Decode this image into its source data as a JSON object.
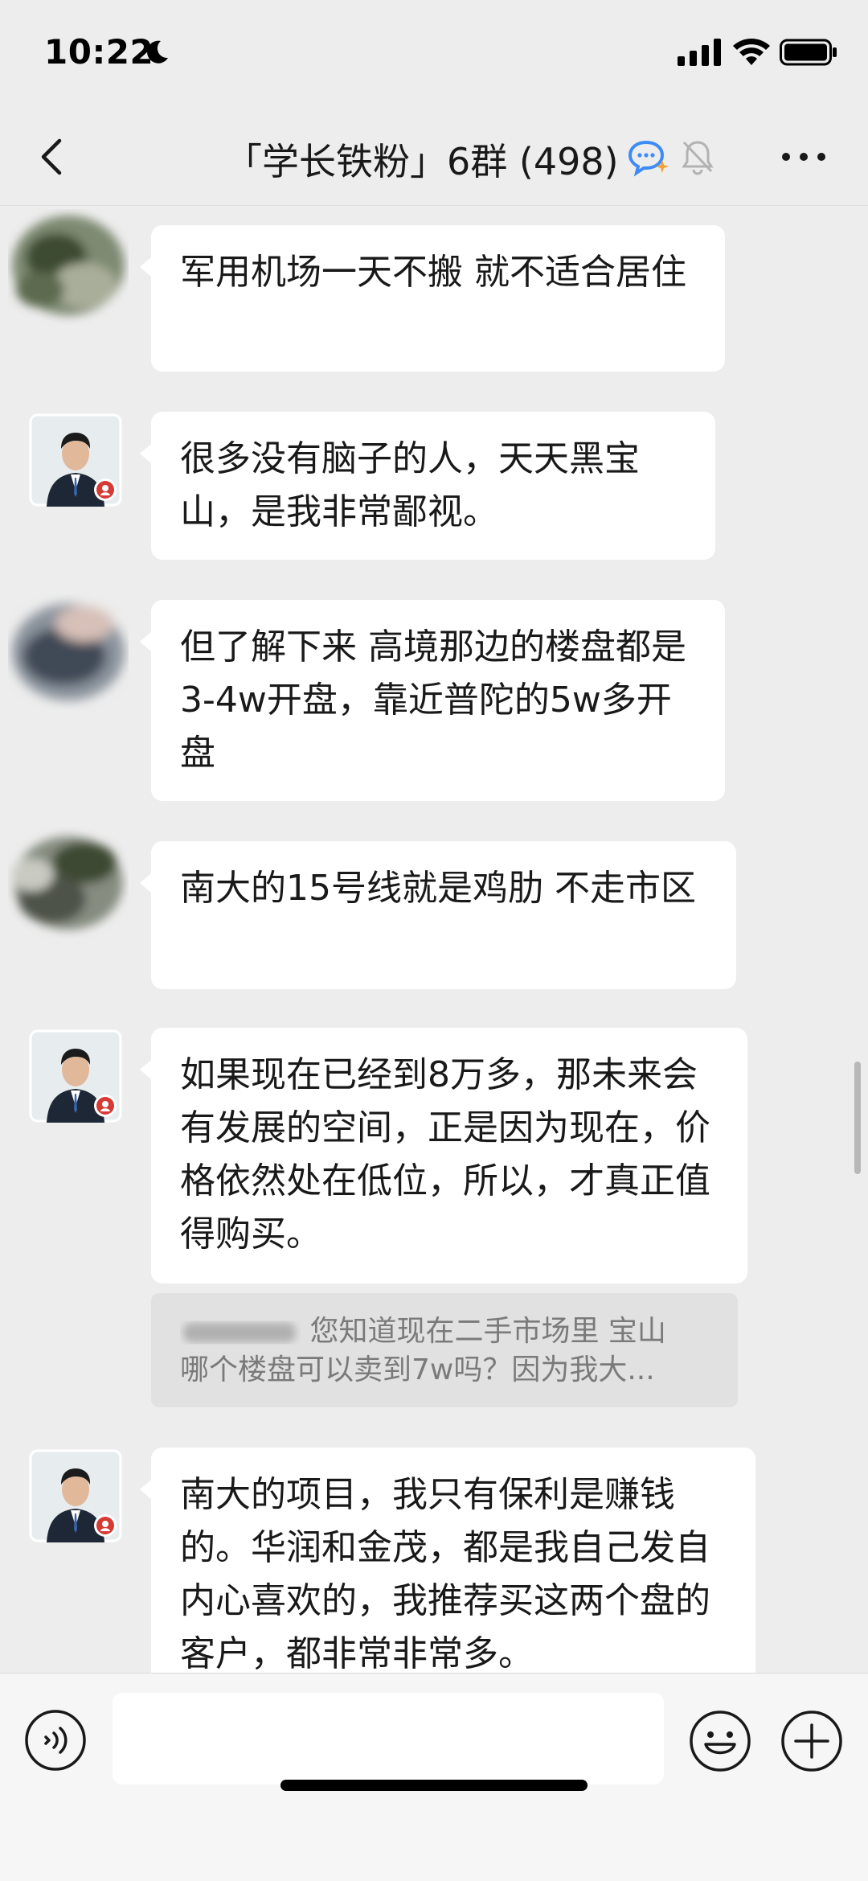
{
  "status_bar": {
    "time": "10:22",
    "icons": [
      "moon-icon",
      "signal-icon",
      "wifi-icon",
      "battery-icon"
    ]
  },
  "nav": {
    "title": "「学长铁粉」6群 (498)",
    "icons": [
      "back-icon",
      "ai-assistant-icon",
      "mute-icon",
      "more-icon"
    ]
  },
  "messages": [
    {
      "sender": "blurred",
      "text": "军用机场一天不搬 就不适合居住"
    },
    {
      "sender": "agent",
      "text": "很多没有脑子的人，天天黑宝山，是我非常鄙视。"
    },
    {
      "sender": "blurred",
      "text": "但了解下来 高境那边的楼盘都是3-4w开盘，靠近普陀的5w多开盘"
    },
    {
      "sender": "blurred",
      "text": "南大的15号线就是鸡肋 不走市区"
    },
    {
      "sender": "agent",
      "text": "如果现在已经到8万多，那未来会有发展的空间，正是因为现在，价格依然处在低位，所以，才真正值得购买。"
    },
    {
      "sender": "agent",
      "text": "南大的项目，我只有保利是赚钱的。华润和金茂，都是我自己发自内心喜欢的，我推荐买这两个盘的客户，都非常非常多。"
    }
  ],
  "quote": {
    "line1": "您知道现在二手市场里 宝山",
    "line2": "哪个楼盘可以卖到7w吗？因为我大..."
  },
  "input_bar": {
    "placeholder": "",
    "icons": [
      "voice-icon",
      "emoji-icon",
      "plus-icon"
    ]
  },
  "colors": {
    "background": "#ededed",
    "bubble": "#ffffff",
    "quote": "#e1e1e1",
    "accent_ai": "#3d8bf7"
  }
}
